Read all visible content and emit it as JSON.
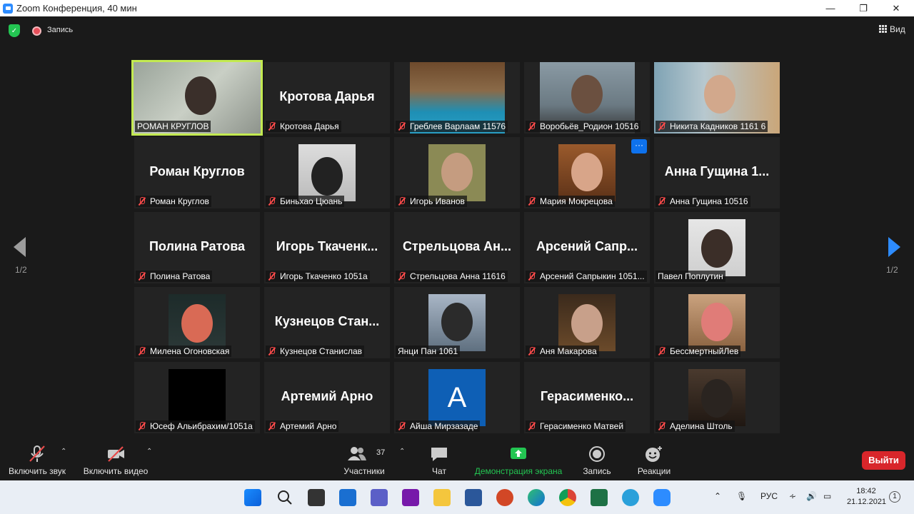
{
  "window": {
    "title": "Zoom Конференция, 40 мин"
  },
  "topbar": {
    "record_label": "Запись",
    "view_label": "Вид"
  },
  "pager": {
    "left": "1/2",
    "right": "1/2"
  },
  "participants": [
    {
      "name": "РОМАН КРУГЛОВ",
      "big": "",
      "video": true,
      "active": true,
      "muted": false
    },
    {
      "name": "Кротова Дарья",
      "big": "Кротова Дарья",
      "video": false,
      "muted": true
    },
    {
      "name": "Греблев Варлаам 11576",
      "big": "",
      "video": true,
      "muted": true
    },
    {
      "name": "Воробьёв_Родион 10516",
      "big": "",
      "video": true,
      "muted": true
    },
    {
      "name": "Никита Кадников 1161 6",
      "big": "",
      "video": true,
      "muted": true
    },
    {
      "name": "Роман Круглов",
      "big": "Роман Круглов",
      "video": false,
      "muted": true
    },
    {
      "name": "Биньхао Цюань",
      "big": "",
      "video": true,
      "muted": true
    },
    {
      "name": "Игорь Иванов",
      "big": "",
      "video": true,
      "muted": true
    },
    {
      "name": "Мария Мокрецова",
      "big": "",
      "video": true,
      "muted": true,
      "more": "···"
    },
    {
      "name": "Анна Гущина 10516",
      "big": "Анна Гущина 1...",
      "video": false,
      "muted": true
    },
    {
      "name": "Полина Ратова",
      "big": "Полина Ратова",
      "video": false,
      "muted": true
    },
    {
      "name": "Игорь Ткаченко 1051а",
      "big": "Игорь Ткаченк...",
      "video": false,
      "muted": true
    },
    {
      "name": "Стрельцова Анна 11616",
      "big": "Стрельцова Ан...",
      "video": false,
      "muted": true
    },
    {
      "name": "Арсений Сапрыкин 1051...",
      "big": "Арсений Сапр...",
      "video": false,
      "muted": true
    },
    {
      "name": "Павел Поплутин",
      "big": "",
      "video": true,
      "muted": false
    },
    {
      "name": "Милена Огоновская",
      "big": "",
      "video": true,
      "muted": true
    },
    {
      "name": "Кузнецов Станислав",
      "big": "Кузнецов Стан...",
      "video": false,
      "muted": true
    },
    {
      "name": "Янци Пан 1061",
      "big": "",
      "video": true,
      "muted": false
    },
    {
      "name": "Аня Макарова",
      "big": "",
      "video": true,
      "muted": true
    },
    {
      "name": "БессмертныйЛев",
      "big": "",
      "video": true,
      "muted": true
    },
    {
      "name": "Юсеф Альибрахим/1051а",
      "big": "",
      "video": true,
      "muted": true
    },
    {
      "name": "Артемий Арно",
      "big": "Артемий Арно",
      "video": false,
      "muted": true
    },
    {
      "name": "Айша Мирзазаде",
      "big": "",
      "video": true,
      "muted": true,
      "avatar_letter": "A"
    },
    {
      "name": "Герасименко Матвей",
      "big": "Герасименко...",
      "video": false,
      "muted": true
    },
    {
      "name": "Аделина Штоль",
      "big": "",
      "video": true,
      "muted": true
    }
  ],
  "toolbar": {
    "audio_label": "Включить звук",
    "video_label": "Включить видео",
    "participants_label": "Участники",
    "participants_count": "37",
    "chat_label": "Чат",
    "share_label": "Демонстрация экрана",
    "record_label": "Запись",
    "reactions_label": "Реакции",
    "leave_label": "Выйти"
  },
  "taskbar": {
    "lang": "РУС",
    "time": "18:42",
    "date": "21.12.2021",
    "notifications": "1"
  },
  "colors": {
    "active_speaker": "#c3ea51",
    "share_green": "#23c552",
    "leave_red": "#d8262b",
    "zoom_blue": "#2d8cff"
  }
}
